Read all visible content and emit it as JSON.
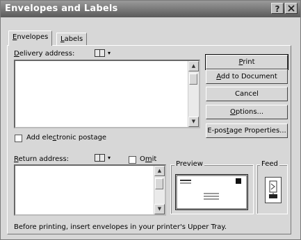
{
  "dialog": {
    "title": "Envelopes and Labels",
    "help_glyph": "?",
    "close_glyph": "X"
  },
  "tabs": [
    {
      "label_underlined": "E",
      "label_rest": "nvelopes",
      "active": true
    },
    {
      "label_underlined": "L",
      "label_rest": "abels",
      "active": false
    }
  ],
  "delivery": {
    "label_underlined": "D",
    "label_rest": "elivery address:",
    "value": ""
  },
  "return": {
    "label_underlined": "R",
    "label_rest": "eturn address:",
    "value": ""
  },
  "address_book_icon": "address-book-icon",
  "dropdown_caret": "▾",
  "omit": {
    "label_pre": "O",
    "label_underlined": "m",
    "label_post": "it",
    "checked": false
  },
  "postage": {
    "label_pre": "Add ele",
    "label_underlined": "c",
    "label_post": "tronic postage",
    "checked": false
  },
  "buttons": {
    "print": {
      "pre": "",
      "u": "P",
      "post": "rint"
    },
    "add": {
      "pre": "",
      "u": "A",
      "post": "dd to Document"
    },
    "cancel": {
      "pre": "Cancel",
      "u": "",
      "post": ""
    },
    "options": {
      "pre": "",
      "u": "O",
      "post": "ptions..."
    },
    "epostage": {
      "pre": "E-pos",
      "u": "t",
      "post": "age Properties..."
    }
  },
  "preview_label": "Preview",
  "feed_label": "Feed",
  "footer_text": "Before printing, insert envelopes in your printer's Upper Tray.",
  "colors": {
    "face": "#d7d7d7",
    "title_bar": "#6f6f6f"
  }
}
